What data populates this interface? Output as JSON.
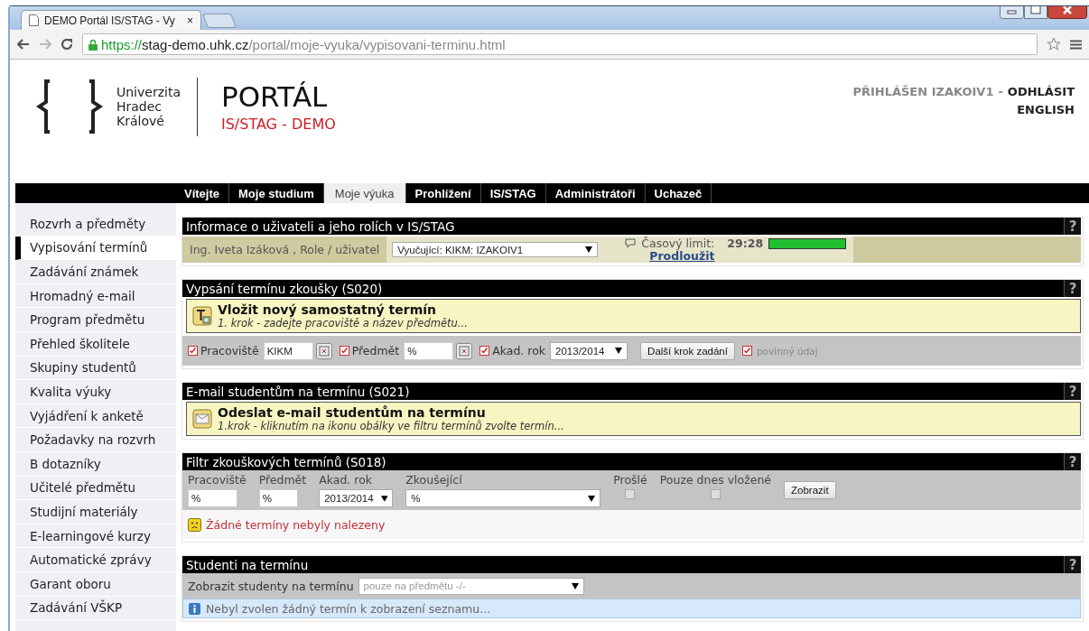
{
  "browser": {
    "tab_title": "DEMO Portál IS/STAG - Vy",
    "tab_close": "×",
    "url_scheme": "https://",
    "url_host": "stag-demo.uhk.cz",
    "url_path": "/portal/moje-vyuka/vypisovani-terminu.html"
  },
  "header": {
    "logo_lines": [
      "Univerzita",
      "Hradec",
      "Králové"
    ],
    "portal_title": "PORTÁL",
    "portal_subtitle": "IS/STAG - DEMO",
    "user_status": "PŘIHLÁŠEN IZAKOIV1",
    "separator": "-",
    "logout": "ODHLÁSIT",
    "language": "ENGLISH"
  },
  "nav": [
    {
      "label": "Vítejte",
      "selected": false
    },
    {
      "label": "Moje studium",
      "selected": false
    },
    {
      "label": "Moje výuka",
      "selected": true
    },
    {
      "label": "Prohlížení",
      "selected": false
    },
    {
      "label": "IS/STAG",
      "selected": false
    },
    {
      "label": "Administrátoři",
      "selected": false
    },
    {
      "label": "Uchazeč",
      "selected": false
    }
  ],
  "sidebar": [
    {
      "label": "Rozvrh a předměty",
      "selected": false
    },
    {
      "label": "Vypisování termínů",
      "selected": true
    },
    {
      "label": "Zadávání známek",
      "selected": false
    },
    {
      "label": "Hromadný e-mail",
      "selected": false
    },
    {
      "label": "Program předmětu",
      "selected": false
    },
    {
      "label": "Přehled školitele",
      "selected": false
    },
    {
      "label": "Skupiny studentů",
      "selected": false
    },
    {
      "label": "Kvalita výuky",
      "selected": false
    },
    {
      "label": "Vyjádření k anketě",
      "selected": false
    },
    {
      "label": "Požadavky na rozvrh",
      "selected": false
    },
    {
      "label": "B dotazníky",
      "selected": false
    },
    {
      "label": "Učitelé předmětu",
      "selected": false
    },
    {
      "label": "Studijní materiály",
      "selected": false
    },
    {
      "label": "E-learningové kurzy",
      "selected": false
    },
    {
      "label": "Automatické zprávy",
      "selected": false
    },
    {
      "label": "Garant oboru",
      "selected": false
    },
    {
      "label": "Zadávání VŠKP",
      "selected": false
    }
  ],
  "sections": [
    {
      "kind": "user_info",
      "title": "Informace o uživateli a jeho rolích v IS/STAG",
      "help": "?",
      "user": "Ing. Iveta Izáková , Role / uživatel",
      "role_select": "Vyučující: KIKM: IZAKOIV1",
      "timer_label": "Časový limit:",
      "timer_value": "29:28",
      "level": 1,
      "extend_link": "Prodloužit"
    },
    {
      "kind": "new_term",
      "title": "Vypsání termínu zkoušky (S020)",
      "help": "?",
      "heading": "Vložit nový samostatný termín",
      "step": "1. krok - zadejte pracoviště a název předmětu...",
      "fields": [
        {
          "kind": "text",
          "label": "Pracoviště",
          "checked": true,
          "value": "KIKM"
        },
        {
          "kind": "text",
          "label": "Předmět",
          "checked": true,
          "value": "%"
        },
        {
          "kind": "select",
          "label": "Akad. rok",
          "checked": true,
          "value": "2013/2014"
        }
      ],
      "button": "Další krok zadání",
      "legend": "povinný údaj",
      "legend_checked": true
    },
    {
      "kind": "email",
      "title": "E-mail studentům na termínu (S021)",
      "help": "?",
      "heading": "Odeslat e-mail studentům na termínu",
      "step": "1.krok - kliknutím na ikonu obálky ve filtru termínů zvolte termín..."
    },
    {
      "kind": "filter",
      "title": "Filtr zkouškových termínů (S018)",
      "help": "?",
      "columns": [
        {
          "kind": "text",
          "label": "Pracoviště",
          "value": "%"
        },
        {
          "kind": "text",
          "label": "Předmět",
          "value": "%"
        },
        {
          "kind": "select",
          "label": "Akad. rok",
          "value": "2013/2014"
        },
        {
          "kind": "wide-select",
          "label": "Zkoušející",
          "value": "%"
        },
        {
          "kind": "checkbox",
          "label": "Prošlé",
          "checked": false
        },
        {
          "kind": "checkbox",
          "label": "Pouze dnes vložené",
          "checked": false
        }
      ],
      "button": "Zobrazit",
      "message": "Žádné termíny nebyly nalezeny"
    },
    {
      "kind": "students",
      "title": "Studenti na termínu",
      "help": "?",
      "label": "Zobrazit studenty na termínu",
      "select": "pouze na předmětu -/-",
      "info": "Nebyl zvolen žádný termín k zobrazení seznamu..."
    }
  ]
}
